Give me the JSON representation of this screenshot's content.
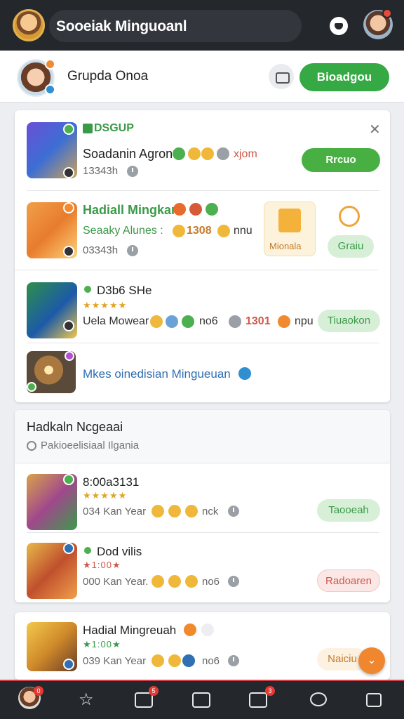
{
  "topbar": {
    "title": "Sooeiak Minguoanl",
    "icons": [
      "avatar-icon",
      "shield-icon",
      "profile-icon"
    ]
  },
  "group": {
    "name": "Grupda Onoa",
    "join_label": "Bioadgou"
  },
  "feed": [
    {
      "badge": "DSGUP",
      "line": "Soadanin Agron",
      "suffix": "xjom",
      "meta": "13343h",
      "button": "Rrcuo"
    },
    {
      "name": "Hadiall Mingkan",
      "line_a": "Seaaky Alunes :",
      "line_b": "1308",
      "line_c": "nnu",
      "meta": "03343h",
      "tile_label": "Mionala",
      "tile2_label": "Graiu"
    },
    {
      "name": "D3b6 SHe",
      "stars": "★★★★★",
      "line": "Uela Mowear",
      "count_a": "no6",
      "count_b": "1301",
      "count_c": "npu",
      "button": "Tiuaokon"
    },
    {
      "line": "Mkes oinedisian Mingueuan"
    }
  ],
  "section": {
    "title": "Hadkaln Ncgeaai",
    "subtitle": "Pakioeelisiaal Ilgania"
  },
  "list": [
    {
      "name": "8:00a3131",
      "stars": "★★★★★",
      "meta": "034 Kan Year",
      "count": "nck",
      "button": "Taooeah"
    },
    {
      "name": "Dod vilis",
      "stars": "★1:00★",
      "meta": "000 Kan Year.",
      "count": "no6",
      "button": "Radoaren"
    },
    {
      "name": "Hadial Mingreuah",
      "stars": "★1:00★",
      "meta": "039 Kan Year",
      "count": "no6",
      "button": "Naiciu"
    }
  ],
  "nav": {
    "badges": [
      "0",
      "5",
      "3"
    ]
  },
  "colors": {
    "topbar": "#24272c",
    "accent_green": "#35a944",
    "fab_orange": "#f0862e",
    "nav_border": "#d1434a"
  }
}
